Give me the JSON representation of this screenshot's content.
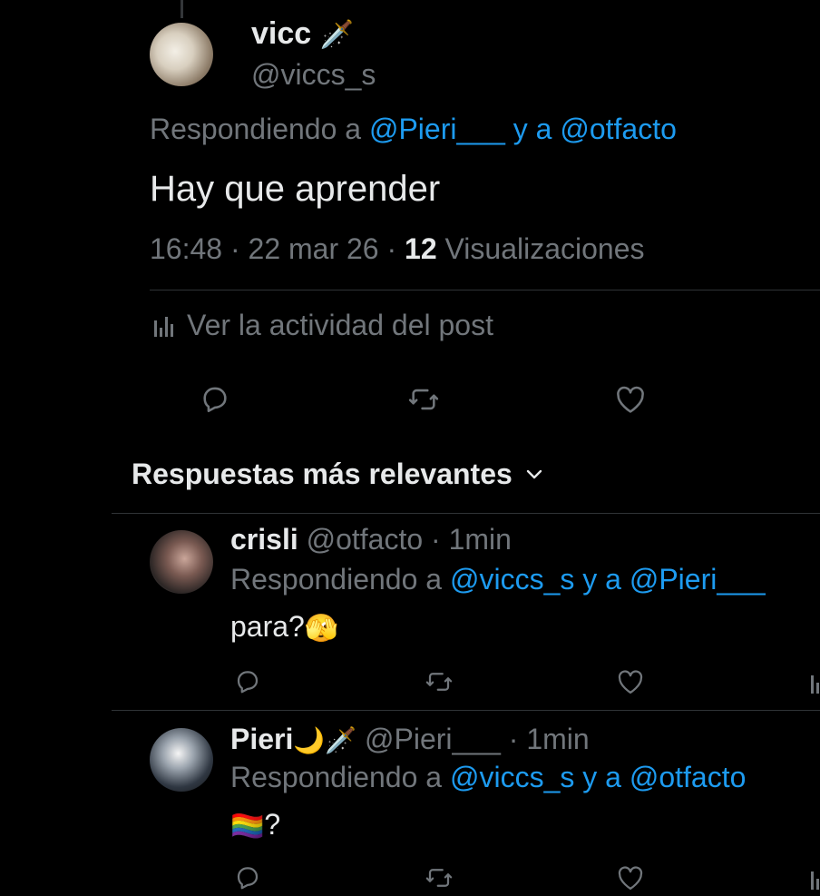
{
  "main_tweet": {
    "display_name": "vicc",
    "name_emoji": "🗡️",
    "handle": "@viccs_s",
    "replying_prefix": "Respondiendo a",
    "replying_user1": "@Pieri___",
    "replying_join": "y a",
    "replying_user2": "@otfacto",
    "text": "Hay que aprender",
    "time": "16:48",
    "date": "22 mar 26",
    "views_count": "12",
    "views_label": "Visualizaciones",
    "activity_label": "Ver la actividad del post"
  },
  "replies_sort": {
    "label": "Respuestas más relevantes"
  },
  "replies": [
    {
      "display_name": "crisli",
      "handle": "@otfacto",
      "time": "1min",
      "replying_prefix": "Respondiendo a",
      "replying_user1": "@viccs_s",
      "replying_join": "y a",
      "replying_user2": "@Pieri___",
      "text": "para?",
      "text_emoji": "🫣"
    },
    {
      "display_name": "Pieri",
      "name_emoji": "🌙🗡️",
      "handle": "@Pieri___",
      "time": "1min",
      "replying_prefix": "Respondiendo a",
      "replying_user1": "@viccs_s",
      "replying_join": "y a",
      "replying_user2": "@otfacto",
      "text_emoji": "🏳️‍🌈",
      "text": "?"
    }
  ],
  "separator": "·",
  "colors": {
    "background": "#000000",
    "text": "#e7e9ea",
    "muted": "#71767b",
    "link": "#1d9bf0",
    "divider": "#2f3336"
  },
  "icons": {
    "reply": "reply-icon",
    "repost": "repost-icon",
    "like": "like-icon",
    "analytics": "analytics-icon",
    "chevron": "chevron-down-icon"
  }
}
